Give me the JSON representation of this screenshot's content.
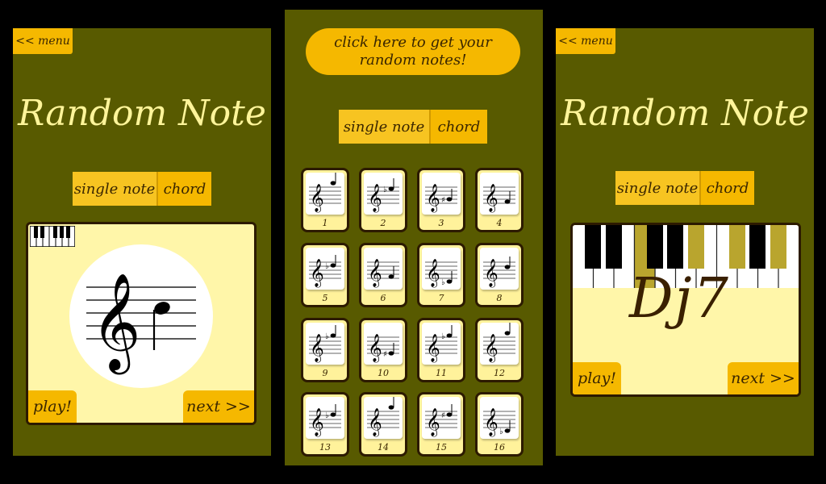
{
  "screens": [
    {
      "menu_label": "<< menu",
      "title": "Random Note",
      "toggle": {
        "single": "single note",
        "chord": "chord"
      },
      "play_label": "play!",
      "next_label": "next >>"
    },
    {
      "random_button": {
        "line1": "click here to get your",
        "line2": "random notes!"
      },
      "toggle": {
        "single": "single note",
        "chord": "chord"
      },
      "tiles": [
        "1",
        "2",
        "3",
        "4",
        "5",
        "6",
        "7",
        "8",
        "9",
        "10",
        "11",
        "12",
        "13",
        "14",
        "15",
        "16"
      ]
    },
    {
      "menu_label": "<< menu",
      "title": "Random Note",
      "toggle": {
        "single": "single note",
        "chord": "chord"
      },
      "chord_name": "Dj7",
      "play_label": "play!",
      "next_label": "next >>"
    }
  ],
  "colors": {
    "background": "#000000",
    "panel": "#585a00",
    "button": "#f5b800",
    "card": "#fff6a9",
    "title": "#fff59a",
    "highlight_key": "#b9a52e"
  },
  "icons": [
    "treble-clef-icon",
    "mini-keyboard-icon"
  ]
}
